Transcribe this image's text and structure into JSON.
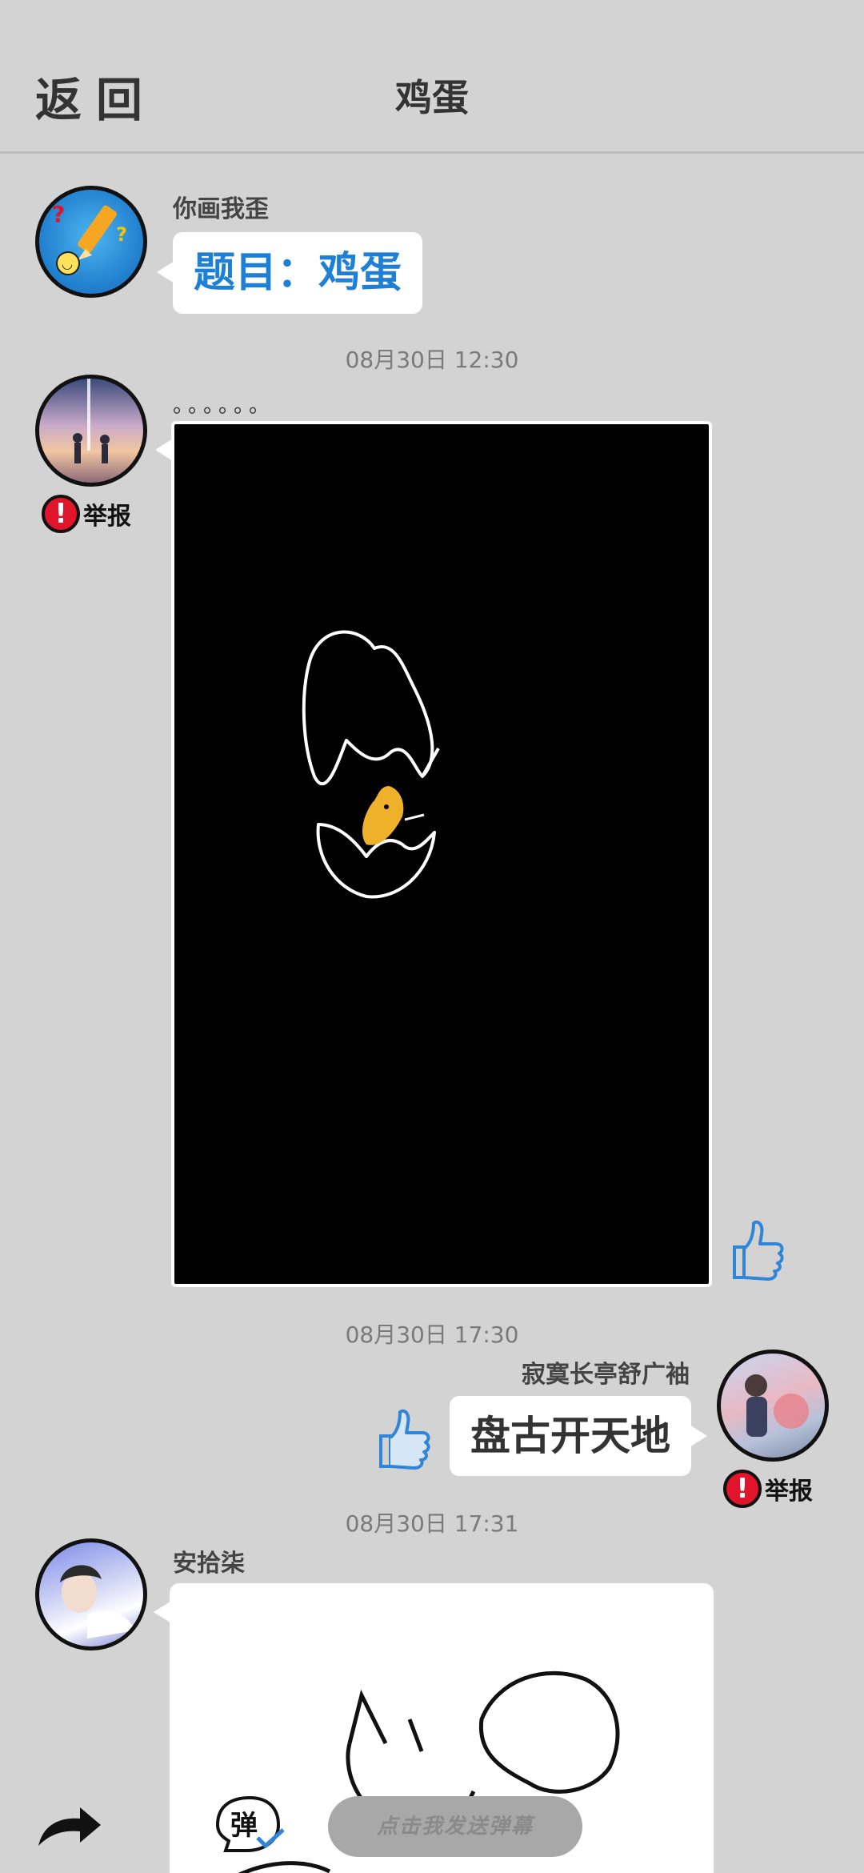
{
  "header": {
    "back_label": "返回",
    "title": "鸡蛋"
  },
  "messages": [
    {
      "sender": "你画我歪",
      "text": "题目：鸡蛋"
    },
    {
      "timestamp": "08月30日  12:30",
      "caption": "。。。。。。",
      "report_label": "举报"
    },
    {
      "timestamp": "08月30日  17:30",
      "sender": "寂寞长亭舒广袖",
      "text": "盘古开天地",
      "report_label": "举报"
    },
    {
      "timestamp": "08月30日  17:31",
      "sender": "安拾柒"
    }
  ],
  "bottom_bar": {
    "danmu_badge": "弹",
    "danmu_placeholder": "点击我发送弹幕"
  },
  "colors": {
    "background": "#d3d3d3",
    "topic_blue": "#1e7fd6",
    "report_red": "#e0142a",
    "like_blue": "#2f86d8"
  },
  "icons": [
    "share-arrow-icon",
    "danmu-icon",
    "thumbs-up-icon",
    "report-icon"
  ]
}
